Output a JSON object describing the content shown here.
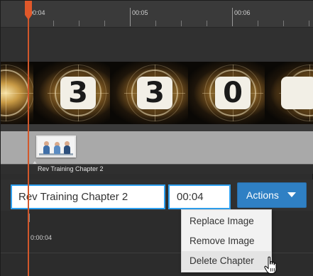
{
  "ruler": {
    "labels": [
      "00:04",
      "00:05",
      "00:06"
    ]
  },
  "film_strip": {
    "digits": [
      "3",
      "3",
      "0"
    ]
  },
  "chapter": {
    "track_label": "Rev Training Chapter 2",
    "name_value": "Rev Training Chapter 2",
    "time_value": "00:04"
  },
  "actions": {
    "label": "Actions"
  },
  "menu": {
    "items": [
      "Replace Image",
      "Remove Image",
      "Delete Chapter"
    ]
  },
  "timeline": {
    "readout": "0:00:04"
  },
  "colors": {
    "accent": "#2f80c4",
    "focus_border": "#2ea0f0",
    "playhead": "#e0582a"
  }
}
